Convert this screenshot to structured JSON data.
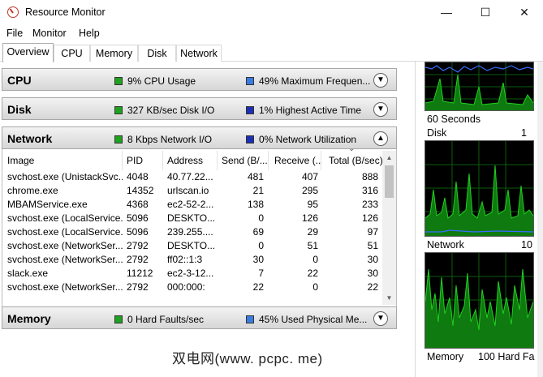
{
  "window": {
    "title": "Resource Monitor",
    "minimize": "—",
    "maximize": "☐",
    "close": "✕"
  },
  "menu": [
    "File",
    "Monitor",
    "Help"
  ],
  "tabs": [
    "Overview",
    "CPU",
    "Memory",
    "Disk",
    "Network"
  ],
  "active_tab": "Overview",
  "sections": {
    "cpu": {
      "title": "CPU",
      "stat1": "9% CPU Usage",
      "stat2": "49% Maximum Frequen...",
      "chevron": "▼"
    },
    "disk": {
      "title": "Disk",
      "stat1": "327 KB/sec Disk I/O",
      "stat2": "1% Highest Active Time",
      "chevron": "▼"
    },
    "network": {
      "title": "Network",
      "stat1": "8 Kbps Network I/O",
      "stat2": "0% Network Utilization",
      "chevron": "▲"
    },
    "memory": {
      "title": "Memory",
      "stat1": "0 Hard Faults/sec",
      "stat2": "45% Used Physical Me...",
      "chevron": "▼"
    }
  },
  "network_table": {
    "columns": [
      "Image",
      "PID",
      "Address",
      "Send (B/...",
      "Receive (...",
      "Total (B/sec)"
    ],
    "sort_indicator": "⌄",
    "rows": [
      [
        "svchost.exe (UnistackSvc...",
        "4048",
        "40.77.22...",
        "481",
        "407",
        "888"
      ],
      [
        "chrome.exe",
        "14352",
        "urlscan.io",
        "21",
        "295",
        "316"
      ],
      [
        "MBAMService.exe",
        "4368",
        "ec2-52-2...",
        "138",
        "95",
        "233"
      ],
      [
        "svchost.exe (LocalService...",
        "5096",
        "DESKTO...",
        "0",
        "126",
        "126"
      ],
      [
        "svchost.exe (LocalService...",
        "5096",
        "239.255....",
        "69",
        "29",
        "97"
      ],
      [
        "svchost.exe (NetworkSer...",
        "2792",
        "DESKTO...",
        "0",
        "51",
        "51"
      ],
      [
        "svchost.exe (NetworkSer...",
        "2792",
        "ff02::1:3",
        "30",
        "0",
        "30"
      ],
      [
        "slack.exe",
        "11212",
        "ec2-3-12...",
        "7",
        "22",
        "30"
      ],
      [
        "svchost.exe (NetworkSer...",
        "2792",
        "000:000:",
        "22",
        "0",
        "22"
      ]
    ]
  },
  "right_pane": {
    "graph1_caption": "60 Seconds",
    "graph2_label": "Disk",
    "graph2_scale": "1",
    "graph3_label": "Network",
    "graph3_scale": "10",
    "graph4_label": "Memory",
    "graph4_scale": "100 Hard Fa"
  },
  "watermark": "双电网(www. pcpc. me)",
  "colors": {
    "graph_bg": "#000000",
    "graph_line": "#1fd11f",
    "graph_fill": "#0f7a0f",
    "graph_blue": "#3a6cff",
    "grid": "#0a5c0a"
  }
}
